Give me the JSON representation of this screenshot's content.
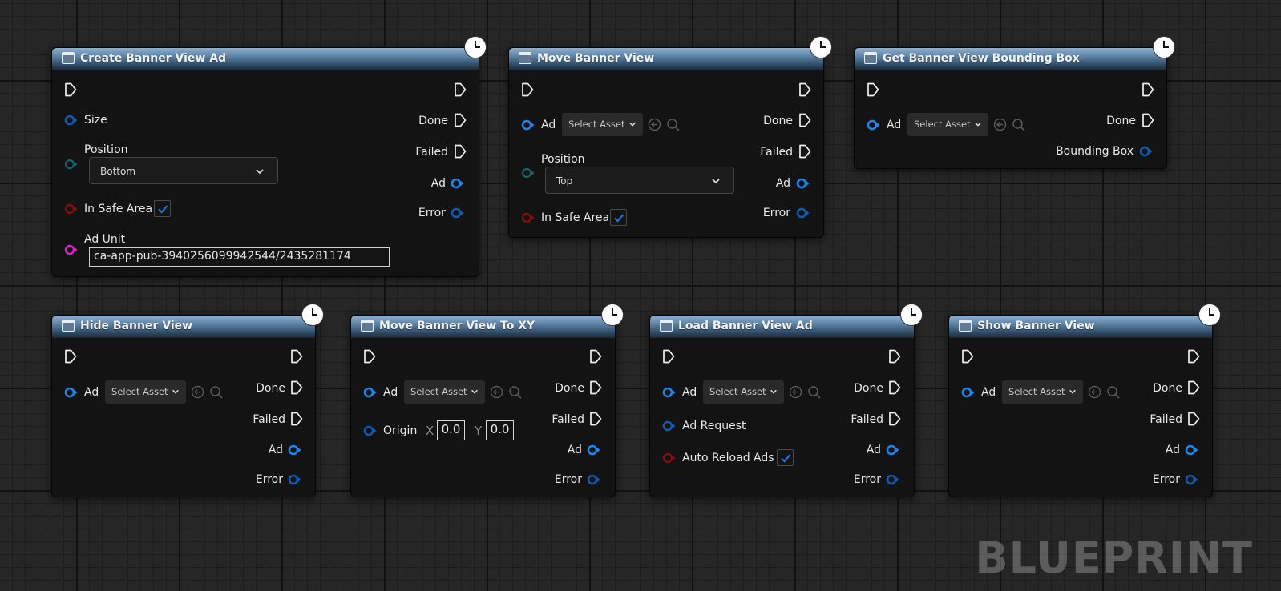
{
  "nodes": {
    "create": {
      "title": "Create Banner View Ad",
      "size": "Size",
      "position": "Position",
      "position_value": "Bottom",
      "in_safe_area": "In Safe Area",
      "ad_unit": "Ad Unit",
      "ad_unit_value": "ca-app-pub-3940256099942544/2435281174",
      "done": "Done",
      "failed": "Failed",
      "ad": "Ad",
      "error": "Error"
    },
    "move": {
      "title": "Move Banner View",
      "ad": "Ad",
      "select": "Select Asset",
      "position": "Position",
      "position_value": "Top",
      "in_safe_area": "In Safe Area",
      "done": "Done",
      "failed": "Failed",
      "ad_out": "Ad",
      "error": "Error"
    },
    "bounds": {
      "title": "Get Banner View Bounding Box",
      "ad": "Ad",
      "select": "Select Asset",
      "done": "Done",
      "bounding_box": "Bounding Box"
    },
    "hide": {
      "title": "Hide Banner View",
      "ad": "Ad",
      "select": "Select Asset",
      "done": "Done",
      "failed": "Failed",
      "ad_out": "Ad",
      "error": "Error"
    },
    "movexy": {
      "title": "Move Banner View To XY",
      "ad": "Ad",
      "select": "Select Asset",
      "origin": "Origin",
      "x_label": "X",
      "x_value": "0.0",
      "y_label": "Y",
      "y_value": "0.0",
      "done": "Done",
      "failed": "Failed",
      "ad_out": "Ad",
      "error": "Error"
    },
    "load": {
      "title": "Load Banner View Ad",
      "ad": "Ad",
      "select": "Select Asset",
      "ad_request": "Ad Request",
      "auto_reload": "Auto Reload Ads",
      "done": "Done",
      "failed": "Failed",
      "ad_out": "Ad",
      "error": "Error"
    },
    "show": {
      "title": "Show Banner View",
      "ad": "Ad",
      "select": "Select Asset",
      "done": "Done",
      "failed": "Failed",
      "ad_out": "Ad",
      "error": "Error"
    }
  },
  "watermark": "BLUEPRINT",
  "colors": {
    "object_pin": "#1a7fe6",
    "struct_pin": "#0e5fb0",
    "enum_pin": "#0f6b6b",
    "bool_pin": "#8a0a0a",
    "string_pin": "#e21ad1",
    "header": "#4a6a88"
  }
}
